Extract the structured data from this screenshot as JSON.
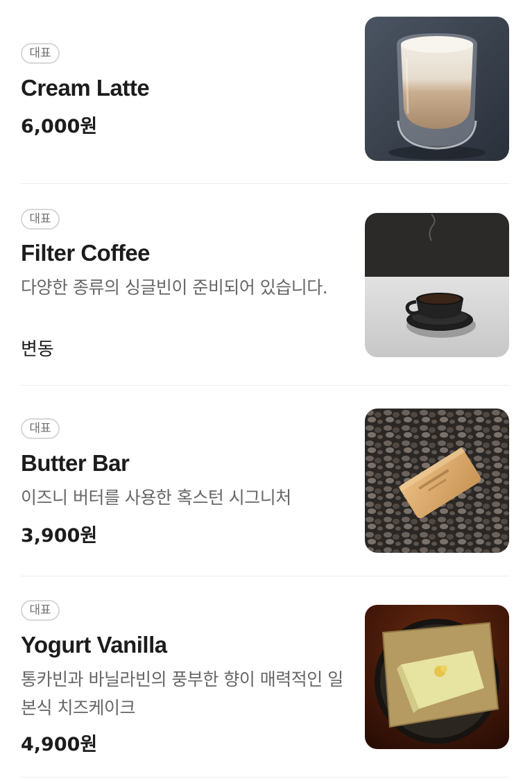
{
  "menu": {
    "items": [
      {
        "badge": "대표",
        "name": "Cream Latte",
        "description": "",
        "price": "6,000원",
        "image": "cream-latte-glass"
      },
      {
        "badge": "대표",
        "name": "Filter Coffee",
        "description": "다양한 종류의 싱글빈이 준비되어 있습니다.",
        "price": "변동",
        "image": "filter-coffee-cup"
      },
      {
        "badge": "대표",
        "name": "Butter Bar",
        "description": "이즈니 버터를 사용한 혹스턴 시그니처",
        "price": "3,900원",
        "image": "butter-bar-packet-on-rocks"
      },
      {
        "badge": "대표",
        "name": "Yogurt Vanilla",
        "description": "통카빈과 바닐라빈의 풍부한 향이 매력적인 일본식 치즈케이크",
        "price": "4,900원",
        "image": "yogurt-vanilla-cheesecake"
      }
    ]
  }
}
